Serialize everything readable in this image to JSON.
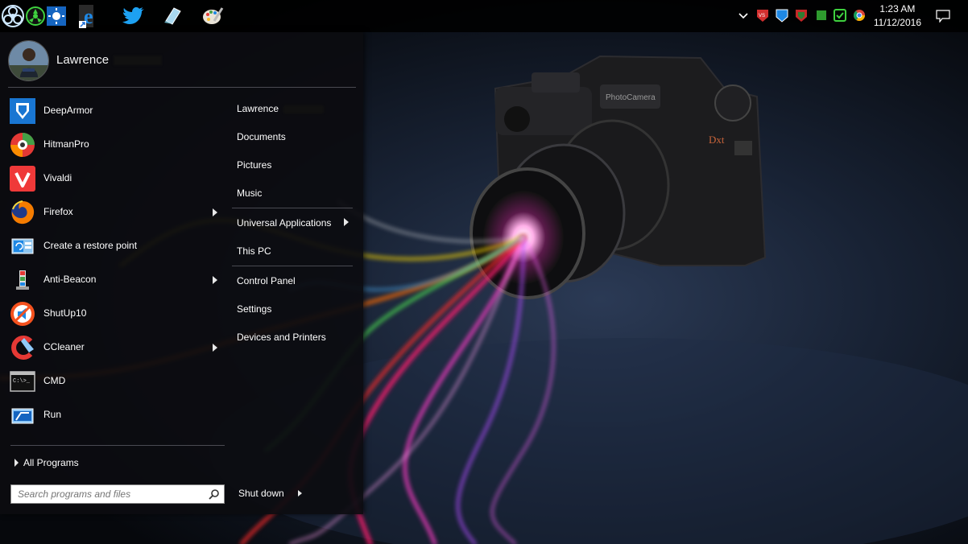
{
  "user": {
    "name": "Lawrence"
  },
  "start_menu": {
    "programs": [
      {
        "label": "DeepArmor",
        "icon": "deeparmor-icon",
        "submenu": false
      },
      {
        "label": "HitmanPro",
        "icon": "hitmanpro-icon",
        "submenu": false
      },
      {
        "label": "Vivaldi",
        "icon": "vivaldi-icon",
        "submenu": false
      },
      {
        "label": "Firefox",
        "icon": "firefox-icon",
        "submenu": true
      },
      {
        "label": "Create a restore point",
        "icon": "restore-point-icon",
        "submenu": false
      },
      {
        "label": "Anti-Beacon",
        "icon": "anti-beacon-icon",
        "submenu": true
      },
      {
        "label": "ShutUp10",
        "icon": "shutup10-icon",
        "submenu": false
      },
      {
        "label": "CCleaner",
        "icon": "ccleaner-icon",
        "submenu": true
      },
      {
        "label": "CMD",
        "icon": "cmd-icon",
        "submenu": false
      },
      {
        "label": "Run",
        "icon": "run-icon",
        "submenu": false
      }
    ],
    "right_links": [
      {
        "label": "Lawrence",
        "submenu": false
      },
      {
        "label": "Documents",
        "submenu": false
      },
      {
        "label": "Pictures",
        "submenu": false
      },
      {
        "label": "Music",
        "submenu": false
      },
      {
        "label": "Universal Applications",
        "submenu": true
      },
      {
        "label": "This PC",
        "submenu": false
      },
      {
        "label": "Control Panel",
        "submenu": false
      },
      {
        "label": "Settings",
        "submenu": false
      },
      {
        "label": "Devices and Printers",
        "submenu": false
      }
    ],
    "all_programs": "All Programs",
    "search_placeholder": "Search programs and files",
    "shutdown_label": "Shut down"
  },
  "taskbar": {
    "pinned_icons": [
      "biohazard-start-icon",
      "weather-sun-icon",
      "edge-icon",
      "twitter-icon",
      "notepad-icon",
      "paint-icon"
    ],
    "tray_icons": [
      "chevron-up-icon",
      "vs-shield-icon",
      "blue-shield-icon",
      "red-shield-icon",
      "green-square-icon",
      "green-check-icon",
      "chrome-icon"
    ],
    "clock": {
      "time": "1:23 AM",
      "date": "11/12/2016"
    }
  },
  "wallpaper": {
    "camera_model": "PhotoCamera",
    "camera_brand": "Dxt"
  }
}
